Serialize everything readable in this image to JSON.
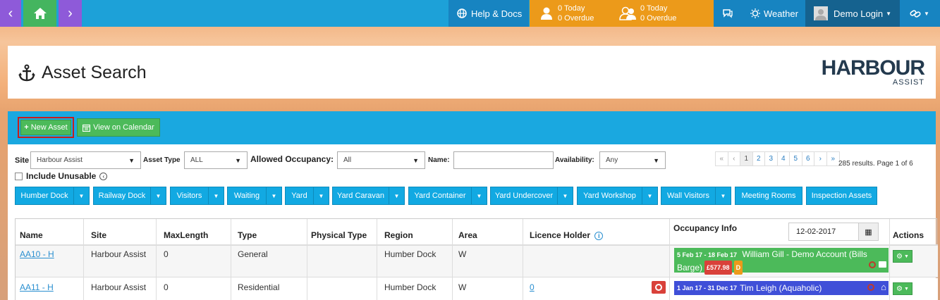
{
  "topbar": {
    "back_icon": "chevron-left-icon",
    "home_icon": "home-icon",
    "forward_icon": "chevron-right-icon",
    "help": "Help & Docs",
    "tasks_today_1": "0 Today",
    "tasks_overdue_1": "0 Overdue",
    "tasks_today_2": "0 Today",
    "tasks_overdue_2": "0 Overdue",
    "weather": "Weather",
    "user": "Demo Login",
    "colors": {
      "purple": "#8e5ad9",
      "green": "#44b55f",
      "blue": "#1da1d8",
      "orange": "#ec9a1a",
      "dark": "#15628f"
    }
  },
  "header": {
    "title": "Asset Search",
    "logo_main": "HARBOUR",
    "logo_sub": "ASSIST"
  },
  "toolbar": {
    "new_asset": "New Asset",
    "view_calendar": "View on Calendar"
  },
  "filters": {
    "site_label": "Site",
    "site_value": "Harbour Assist",
    "asset_type_label": "Asset Type",
    "asset_type_value": "ALL",
    "occupancy_label": "Allowed Occupancy:",
    "occupancy_value": "All",
    "name_label": "Name:",
    "name_value": "",
    "availability_label": "Availability:",
    "availability_value": "Any",
    "include_unusable": "Include Unusable"
  },
  "pagination": {
    "pages": [
      "«",
      "‹",
      "1",
      "2",
      "3",
      "4",
      "5",
      "6",
      "›",
      "»"
    ],
    "results": "285 results. Page 1 of 6"
  },
  "quick_filters": [
    {
      "label": "Humber Dock",
      "dropdown": true
    },
    {
      "label": "Railway Dock",
      "dropdown": true
    },
    {
      "label": "Visitors",
      "dropdown": true
    },
    {
      "label": "Waiting",
      "dropdown": true
    },
    {
      "label": "Yard",
      "dropdown": true
    },
    {
      "label": "Yard Caravan",
      "dropdown": true
    },
    {
      "label": "Yard Container",
      "dropdown": true
    },
    {
      "label": "Yard Undercover",
      "dropdown": true
    },
    {
      "label": "Yard Workshop",
      "dropdown": true
    },
    {
      "label": "Wall Visitors",
      "dropdown": true
    },
    {
      "label": "Meeting Rooms",
      "dropdown": false
    },
    {
      "label": "Inspection Assets",
      "dropdown": false
    }
  ],
  "table": {
    "headers": {
      "name": "Name",
      "site": "Site",
      "maxlength": "MaxLength",
      "type": "Type",
      "physical_type": "Physical Type",
      "region": "Region",
      "area": "Area",
      "licence_holder": "Licence Holder",
      "occupancy": "Occupancy Info",
      "actions": "Actions"
    },
    "occupancy_date": "12-02-2017",
    "rows": [
      {
        "name": "AA10 - H",
        "site": "Harbour Assist",
        "maxlength": "0",
        "type": "General",
        "physical_type": "",
        "region": "Humber Dock",
        "area": "W",
        "licence_holder": "",
        "occ_dates": "5 Feb 17 - 18 Feb 17",
        "occ_line1": "William Gill - Demo Account (Bills",
        "occ_line2": "Barge)",
        "occ_amount": "£577.98",
        "occ_flag": "D",
        "occ_color": "#4cba5a"
      },
      {
        "name": "AA11 - H",
        "site": "Harbour Assist",
        "maxlength": "0",
        "type": "Residential",
        "physical_type": "",
        "region": "Humber Dock",
        "area": "W",
        "licence_holder": "0",
        "occ_dates": "1 Jan 17 - 31 Dec 17",
        "occ_line1": "Tim Leigh (Aquaholic)",
        "occ_color": "#3f4fd8"
      }
    ]
  }
}
